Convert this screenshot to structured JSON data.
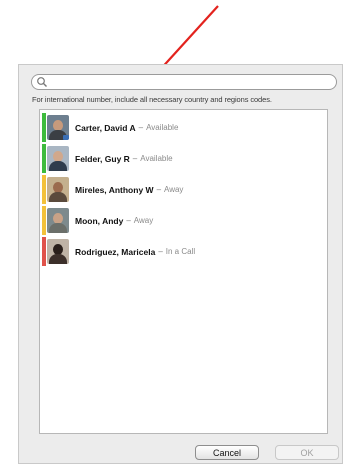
{
  "search": {
    "placeholder": ""
  },
  "hint": "For international number, include all necessary country and regions codes.",
  "contacts": [
    {
      "name": "Carter, David A",
      "separator": "–",
      "status": "Available",
      "status_color": "#3dbb3d",
      "icon": "video-camera-icon"
    },
    {
      "name": "Felder, Guy R",
      "separator": "–",
      "status": "Available",
      "status_color": "#3dbb3d"
    },
    {
      "name": "Mireles, Anthony W",
      "separator": "–",
      "status": "Away",
      "status_color": "#f3c13a"
    },
    {
      "name": "Moon, Andy",
      "separator": "–",
      "status": "Away",
      "status_color": "#f3c13a"
    },
    {
      "name": "Rodriguez, Maricela",
      "separator": "–",
      "status": "In a Call",
      "status_color": "#e0524a"
    }
  ],
  "buttons": {
    "cancel": "Cancel",
    "ok": "OK"
  },
  "annotation": {
    "arrow_color": "#e3231e"
  }
}
